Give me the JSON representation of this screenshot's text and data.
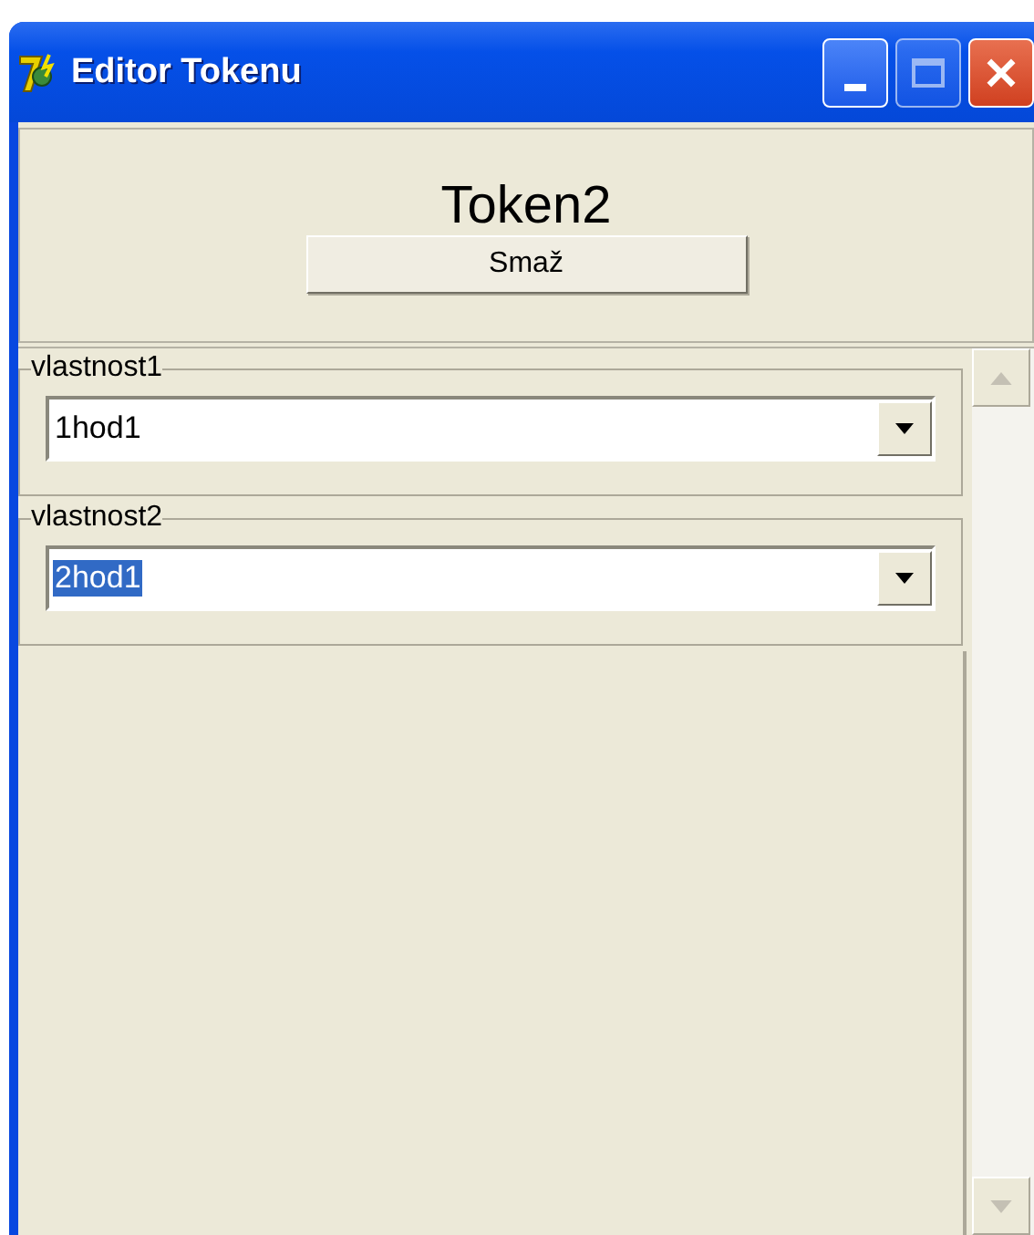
{
  "window": {
    "title": "Editor Tokenu"
  },
  "header": {
    "title": "Token2",
    "button": "Smaž"
  },
  "groups": [
    {
      "label": "vlastnost1",
      "value": "1hod1",
      "text_selected": false
    },
    {
      "label": "vlastnost2",
      "value": "2hod1",
      "text_selected": true
    }
  ]
}
